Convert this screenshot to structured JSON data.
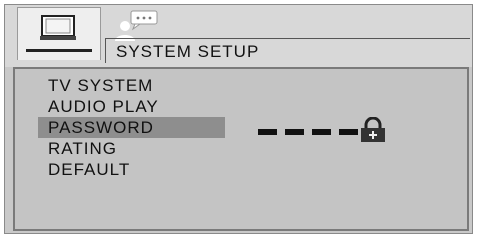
{
  "tabs": [
    {
      "icon": "monitor-icon",
      "active": true
    },
    {
      "icon": "user-chat-icon",
      "active": false
    }
  ],
  "header": {
    "title": "SYSTEM SETUP"
  },
  "menu": {
    "items": [
      {
        "label": "TV SYSTEM",
        "selected": false
      },
      {
        "label": "AUDIO PLAY",
        "selected": false
      },
      {
        "label": "PASSWORD",
        "selected": true
      },
      {
        "label": "RATING",
        "selected": false
      },
      {
        "label": "DEFAULT",
        "selected": false
      }
    ]
  },
  "password": {
    "masked_length": 4,
    "lock_icon": "lock-icon"
  }
}
